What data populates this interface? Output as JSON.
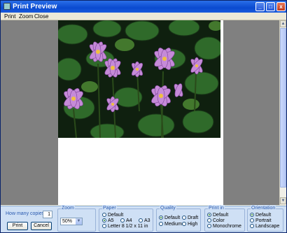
{
  "window": {
    "title": "Print Preview",
    "minimize": "_",
    "maximize": "□",
    "close": "x"
  },
  "menu": {
    "items": [
      "Print",
      "Zoom",
      "Close"
    ]
  },
  "copies": {
    "label": "How many copies:",
    "value": "1",
    "print": "Print",
    "cancel": "Cancel"
  },
  "zoom": {
    "label": "Zoom",
    "value": "50%"
  },
  "paper": {
    "label": "Paper",
    "options": [
      "Default",
      "A5",
      "A4",
      "A3",
      "Letter 8 1/2 x 11 in"
    ],
    "selected": "A5"
  },
  "quality": {
    "label": "Quality",
    "options": [
      "Default",
      "Draft",
      "Medium",
      "High"
    ],
    "selected": "Default"
  },
  "printin": {
    "label": "Print in",
    "options": [
      "Default",
      "Color",
      "Monochrome"
    ],
    "selected": "Default"
  },
  "orientation": {
    "label": "Orientation",
    "options": [
      "Default",
      "Portrait",
      "Landscape"
    ],
    "selected": "Default"
  },
  "colors": {
    "accent": "#0a4ad0",
    "panel": "#cfe0f5",
    "preview": "#808080"
  },
  "icons": {
    "app": "print-preview-app-icon",
    "scroll_up": "scroll-up-arrow-icon",
    "scroll_down": "scroll-down-arrow-icon",
    "dropdown": "chevron-down-icon"
  }
}
